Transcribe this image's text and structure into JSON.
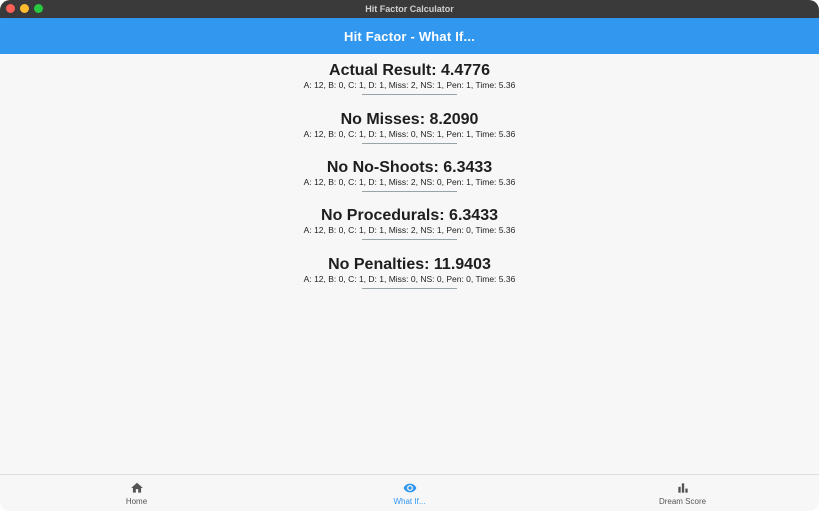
{
  "window": {
    "title": "Hit Factor Calculator"
  },
  "appbar": {
    "title": "Hit Factor - What If..."
  },
  "results": [
    {
      "title": "Actual Result: 4.4776",
      "detail": "A: 12, B: 0, C: 1, D: 1, Miss: 2, NS: 1, Pen: 1, Time: 5.36"
    },
    {
      "title": "No Misses: 8.2090",
      "detail": "A: 12, B: 0, C: 1, D: 1, Miss: 0, NS: 1, Pen: 1, Time: 5.36"
    },
    {
      "title": "No No-Shoots: 6.3433",
      "detail": "A: 12, B: 0, C: 1, D: 1, Miss: 2, NS: 0, Pen: 1, Time: 5.36"
    },
    {
      "title": "No Procedurals: 6.3433",
      "detail": "A: 12, B: 0, C: 1, D: 1, Miss: 2, NS: 1, Pen: 0, Time: 5.36"
    },
    {
      "title": "No Penalties: 11.9403",
      "detail": "A: 12, B: 0, C: 1, D: 1, Miss: 0, NS: 0, Pen: 0, Time: 5.36"
    }
  ],
  "bottom_nav": {
    "items": [
      {
        "label": "Home",
        "icon": "home-icon",
        "active": false
      },
      {
        "label": "What If...",
        "icon": "eye-icon",
        "active": true
      },
      {
        "label": "Dream Score",
        "icon": "bar-chart-icon",
        "active": false
      }
    ]
  },
  "colors": {
    "accent": "#3197ef",
    "titlebar": "#3a3a3a",
    "background": "#f7f7f7"
  }
}
